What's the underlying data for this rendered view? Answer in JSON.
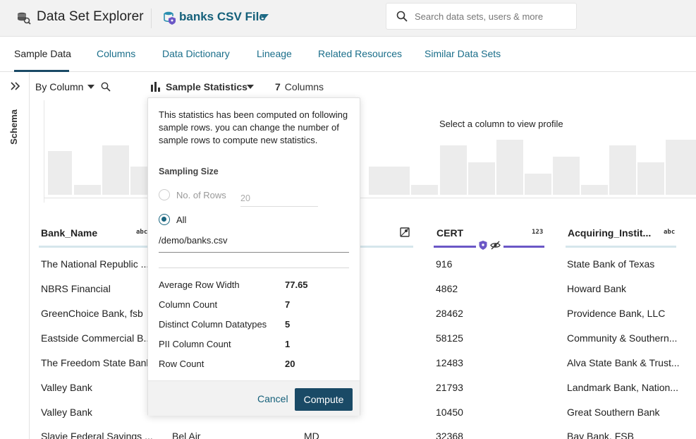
{
  "header": {
    "app_title": "Data Set Explorer",
    "file_name": "banks CSV File",
    "search_placeholder": "Search data sets, users & more"
  },
  "tabs": [
    {
      "label": "Sample Data",
      "active": true
    },
    {
      "label": "Columns"
    },
    {
      "label": "Data Dictionary"
    },
    {
      "label": "Lineage"
    },
    {
      "label": "Related Resources"
    },
    {
      "label": "Similar Data Sets"
    }
  ],
  "sidebar": {
    "schema_label": "Schema"
  },
  "toolbar": {
    "by_column": "By Column",
    "sample_statistics": "Sample Statistics",
    "column_count": "7",
    "columns_label": "Columns"
  },
  "profile": {
    "hint": "Select a column to view profile"
  },
  "columns": [
    {
      "name": "Bank_Name",
      "type": "abc"
    },
    {
      "name": "CERT",
      "type": "123"
    },
    {
      "name": "Acquiring_Instit...",
      "type": "abc"
    }
  ],
  "rows": [
    {
      "bank_name": "The National Republic ...",
      "city": "",
      "st": "",
      "cert": "916",
      "acq": "State Bank of Texas"
    },
    {
      "bank_name": "NBRS Financial",
      "city": "",
      "st": "",
      "cert": "4862",
      "acq": "Howard Bank"
    },
    {
      "bank_name": "GreenChoice Bank, fsb",
      "city": "",
      "st": "",
      "cert": "28462",
      "acq": "Providence Bank, LLC"
    },
    {
      "bank_name": "Eastside Commercial B...",
      "city": "",
      "st": "",
      "cert": "58125",
      "acq": "Community & Southern..."
    },
    {
      "bank_name": "The Freedom State Bank",
      "city": "",
      "st": "",
      "cert": "12483",
      "acq": "Alva State Bank & Trust..."
    },
    {
      "bank_name": "Valley Bank",
      "city": "",
      "st": "",
      "cert": "21793",
      "acq": "Landmark Bank, Nation..."
    },
    {
      "bank_name": "Valley Bank",
      "city": "",
      "st": "",
      "cert": "10450",
      "acq": "Great Southern Bank"
    },
    {
      "bank_name": "Slavie Federal Savings ...",
      "city": "Bel Air",
      "st": "MD",
      "cert": "32368",
      "acq": "Bay Bank, FSB"
    }
  ],
  "popup": {
    "description": "This statistics has been computed on following sample rows. you can change the number of sample rows to compute new statistics.",
    "sampling_size_label": "Sampling Size",
    "option_rows_label": "No. of Rows",
    "rows_value": "20",
    "option_all_label": "All",
    "selected_option": "All",
    "path": "/demo/banks.csv",
    "stats": [
      {
        "label": "Average Row Width",
        "value": "77.65"
      },
      {
        "label": "Column Count",
        "value": "7"
      },
      {
        "label": "Distinct Column Datatypes",
        "value": "5"
      },
      {
        "label": "PII Column Count",
        "value": "1"
      },
      {
        "label": "Row Count",
        "value": "20"
      }
    ],
    "cancel_label": "Cancel",
    "compute_label": "Compute"
  },
  "colors": {
    "accent": "#15607a",
    "primary_button": "#1a4a66",
    "pii_purple": "#6b57c6"
  }
}
